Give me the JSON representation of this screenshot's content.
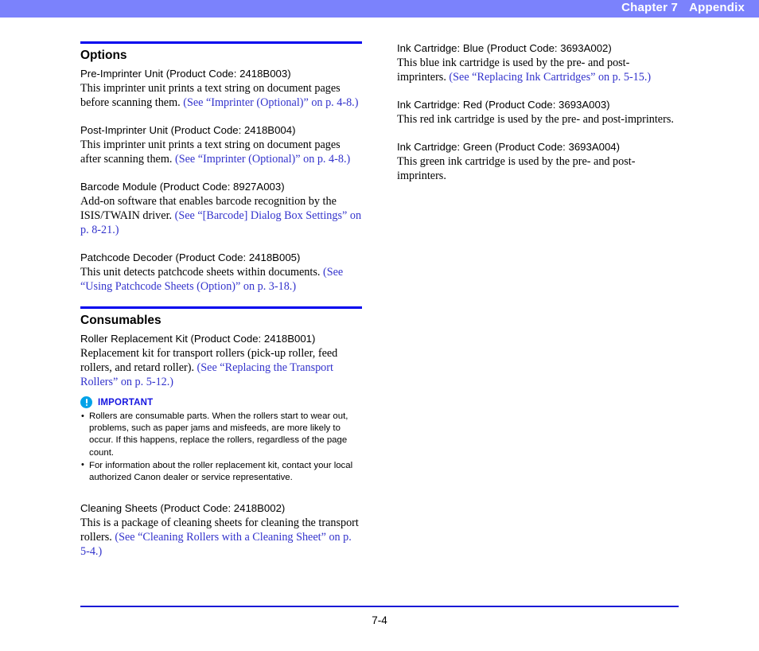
{
  "header": {
    "chapter": "Chapter 7",
    "title": "Appendix",
    "band_color": "#7b82fc"
  },
  "left_column": {
    "sections": [
      {
        "heading": "Options",
        "articles": [
          {
            "title": "Pre-Imprinter Unit (Product Code: 2418B003)",
            "body": "This imprinter unit prints a text string on document pages before scanning them. ",
            "link": "(See “Imprinter (Optional)” on p. 4-8.)"
          },
          {
            "title": "Post-Imprinter Unit (Product Code: 2418B004)",
            "body": "This imprinter unit prints a text string on document pages after scanning them. ",
            "link": "(See “Imprinter (Optional)” on p. 4-8.)"
          },
          {
            "title": "Barcode Module (Product Code: 8927A003)",
            "body": "Add-on software that enables barcode recognition by the ISIS/TWAIN driver. ",
            "link": "(See “[Barcode] Dialog Box Settings” on p. 8-21.)"
          },
          {
            "title": "Patchcode Decoder (Product Code: 2418B005)",
            "body": "This unit detects patchcode sheets within documents. ",
            "link": "(See “Using Patchcode Sheets (Option)” on p. 3-18.)"
          }
        ]
      },
      {
        "heading": "Consumables",
        "articles": [
          {
            "title": "Roller Replacement Kit (Product Code: 2418B001)",
            "body": "Replacement kit for transport rollers (pick-up roller, feed rollers, and retard roller). ",
            "link": "(See “Replacing the Transport Rollers” on p. 5-12.)"
          },
          {
            "title": "Cleaning Sheets (Product Code: 2418B002)",
            "body": "This is a package of cleaning sheets for cleaning the transport rollers. ",
            "link": "(See “Cleaning Rollers with a Cleaning Sheet” on p. 5-4.)"
          }
        ]
      }
    ],
    "notice": {
      "icon": "important-exclamation-icon",
      "label": "IMPORTANT",
      "label_color": "#1414e0",
      "icon_color": "#00a2e8",
      "items": [
        "Rollers are consumable parts. When the rollers start to wear out, problems, such as paper jams and misfeeds, are more likely to occur. If this happens, replace the rollers, regardless of the page count.",
        "For information about the roller replacement kit, contact your local authorized Canon dealer or service representative."
      ]
    }
  },
  "right_column": {
    "articles": [
      {
        "title": "Ink Cartridge: Blue (Product Code: 3693A002)",
        "body": "This blue ink cartridge is used by the pre- and post-imprinters. ",
        "link": "(See “Replacing Ink Cartridges” on p. 5-15.)"
      },
      {
        "title": "Ink Cartridge: Red (Product Code: 3693A003)",
        "body": "This red ink cartridge is used by the pre- and post-imprinters.",
        "link": ""
      },
      {
        "title": "Ink Cartridge: Green (Product Code: 3693A004)",
        "body": "This green ink cartridge is used by the pre- and post-imprinters.",
        "link": ""
      }
    ]
  },
  "footer": {
    "page_number": "7-4",
    "rule_color": "#1a1ad6"
  }
}
